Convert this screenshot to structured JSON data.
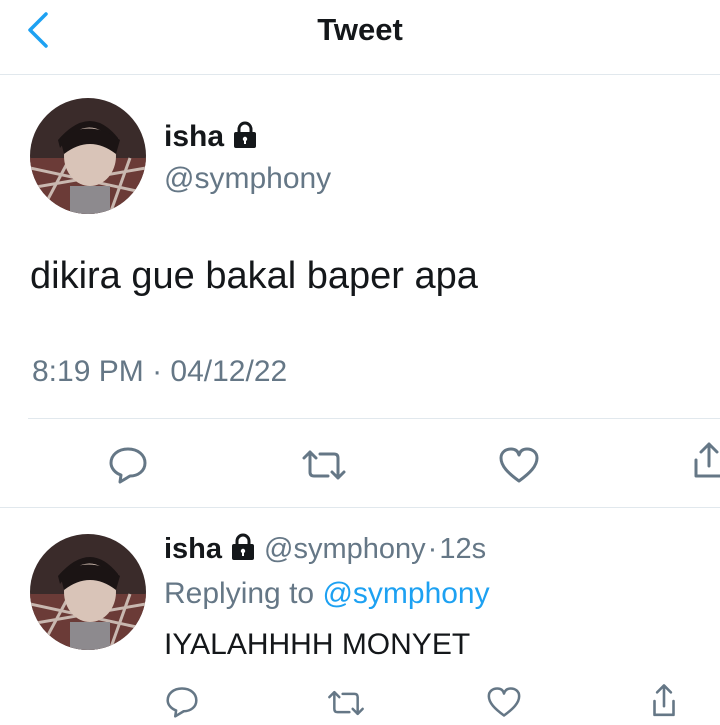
{
  "header": {
    "title": "Tweet",
    "back_icon": "chevron-left-icon"
  },
  "tweet": {
    "name": "isha",
    "handle": "@symphony",
    "text": "dikira gue bakal baper apa",
    "time": "8:19 PM",
    "date_sep": "·",
    "date": "04/12/22",
    "actions": [
      "reply-icon",
      "retweet-icon",
      "like-icon",
      "share-icon"
    ]
  },
  "reply": {
    "name": "isha",
    "handle": "@symphony",
    "sep": "·",
    "age": "12s",
    "replying_prefix": "Replying to",
    "replying_to": "@symphony",
    "text": "IYALAHHHH MONYET",
    "actions": [
      "reply-icon",
      "retweet-icon",
      "like-icon",
      "share-icon"
    ]
  },
  "colors": {
    "accent": "#1da1f2",
    "muted": "#657786",
    "text": "#14171a",
    "divider": "#e1e8ed"
  }
}
